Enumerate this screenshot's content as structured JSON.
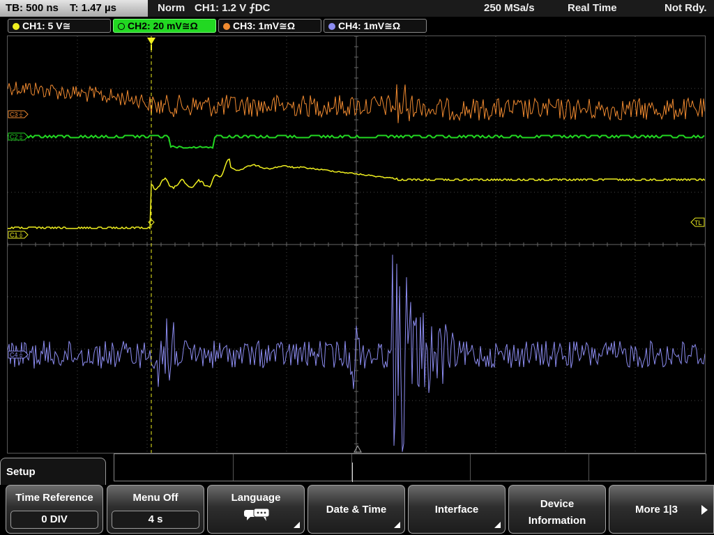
{
  "status": {
    "timebase": "TB: 500 ns",
    "trigger_time": "T: 1.47 µs",
    "mode": "Norm",
    "trigger": "CH1: 1.2 V ⨍DC",
    "sample_rate": "250 MSa/s",
    "acquisition": "Real Time",
    "state": "Not Rdy."
  },
  "channels": [
    {
      "label": "CH1: 5 V≅",
      "color": "#f0f020"
    },
    {
      "label": "CH2: 20 mV≅Ω",
      "color": "#22d822",
      "active": true
    },
    {
      "label": "CH3: 1mV≅Ω",
      "color": "#f08a30"
    },
    {
      "label": "CH4: 1mV≅Ω",
      "color": "#8c8cf0"
    }
  ],
  "markers": {
    "ch3": "C3⏚",
    "ch2": "C2⏚",
    "ch1": "C1⏚",
    "ch4": "C4⏚",
    "trigger_level": "TL"
  },
  "menu": {
    "title": "Setup",
    "softkeys": [
      {
        "label": "Time Reference",
        "value": "0 DIV"
      },
      {
        "label": "Menu Off",
        "value": "4 s"
      },
      {
        "label": "Language",
        "icon": "speech-bubbles-icon"
      },
      {
        "label": "Date & Time"
      },
      {
        "label": "Interface"
      },
      {
        "label_line1": "Device",
        "label_line2": "Information"
      },
      {
        "label": "More 1|3"
      }
    ]
  },
  "colors": {
    "ch1": "#f0f020",
    "ch2": "#22d822",
    "ch3": "#f08a30",
    "ch4": "#8c8cf0",
    "grid": "#4a4a4a"
  }
}
